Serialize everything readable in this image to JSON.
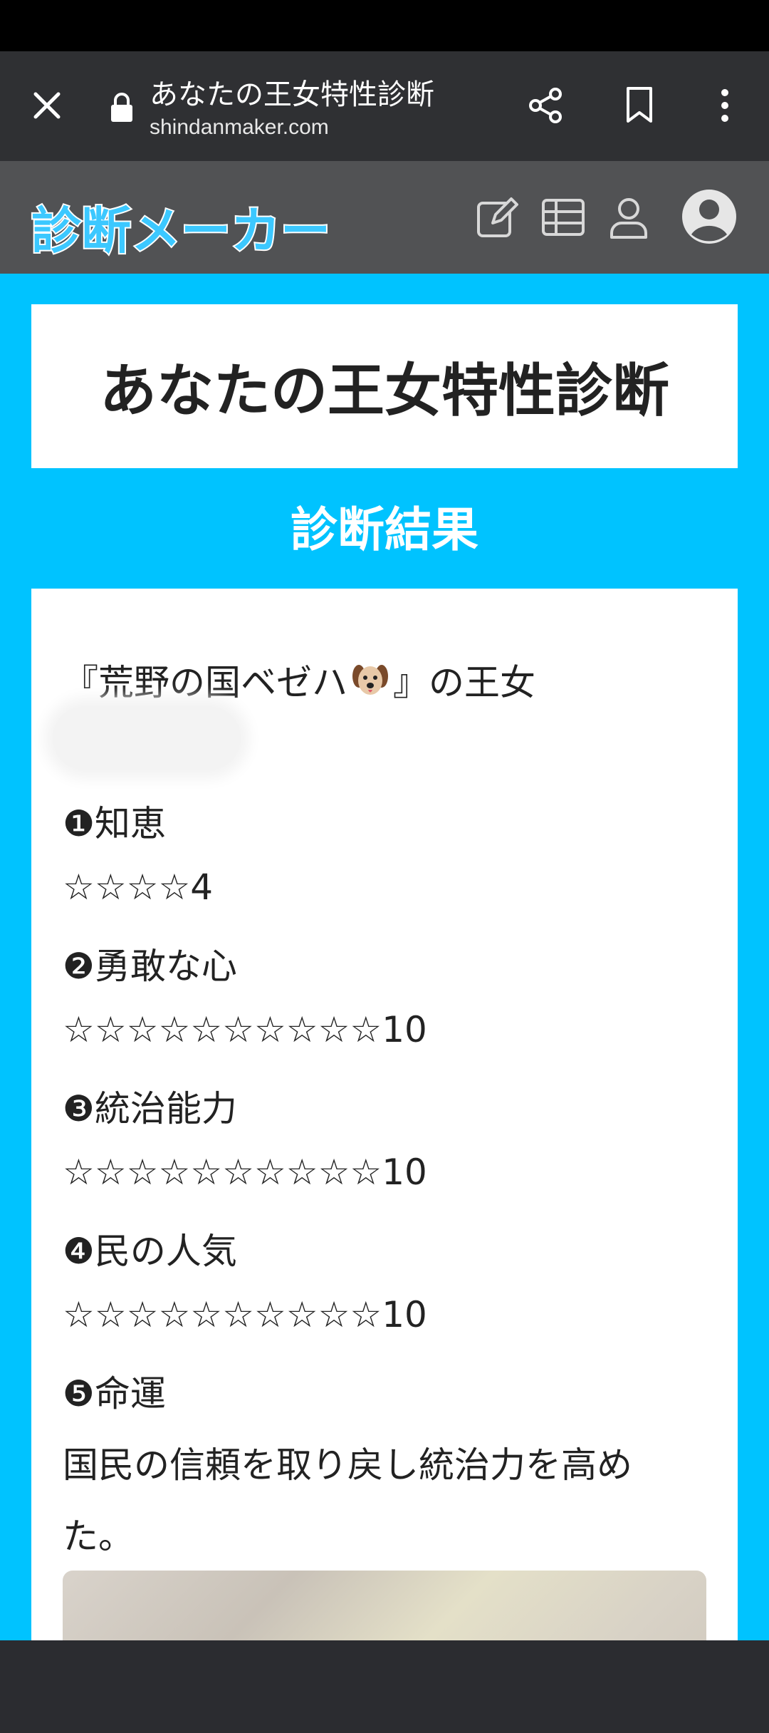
{
  "browser": {
    "page_title": "あなたの王女特性診断",
    "url": "shindanmaker.com"
  },
  "site": {
    "logo_text": "診断メーカー",
    "accent_color": "#00c3ff",
    "icons": [
      "edit-icon",
      "table-icon",
      "user-icon",
      "account-avatar-icon"
    ]
  },
  "page": {
    "title": "あなたの王女特性診断",
    "result_heading": "診断結果"
  },
  "result": {
    "line_country_prefix": "『荒野の国ベゼハ",
    "line_country_suffix": "』の王女",
    "item1_label": "❶知恵",
    "item1_stars": "☆☆☆☆4",
    "item2_label": "❷勇敢な心",
    "item2_stars": "☆☆☆☆☆☆☆☆☆☆10",
    "item3_label": "❸統治能力",
    "item3_stars": "☆☆☆☆☆☆☆☆☆☆10",
    "item4_label": "❹民の人気",
    "item4_stars": "☆☆☆☆☆☆☆☆☆☆10",
    "item5_label": "❺命運",
    "fate_line1": "国民の信頼を取り戻し統治力を高め",
    "fate_line2": "た。"
  }
}
